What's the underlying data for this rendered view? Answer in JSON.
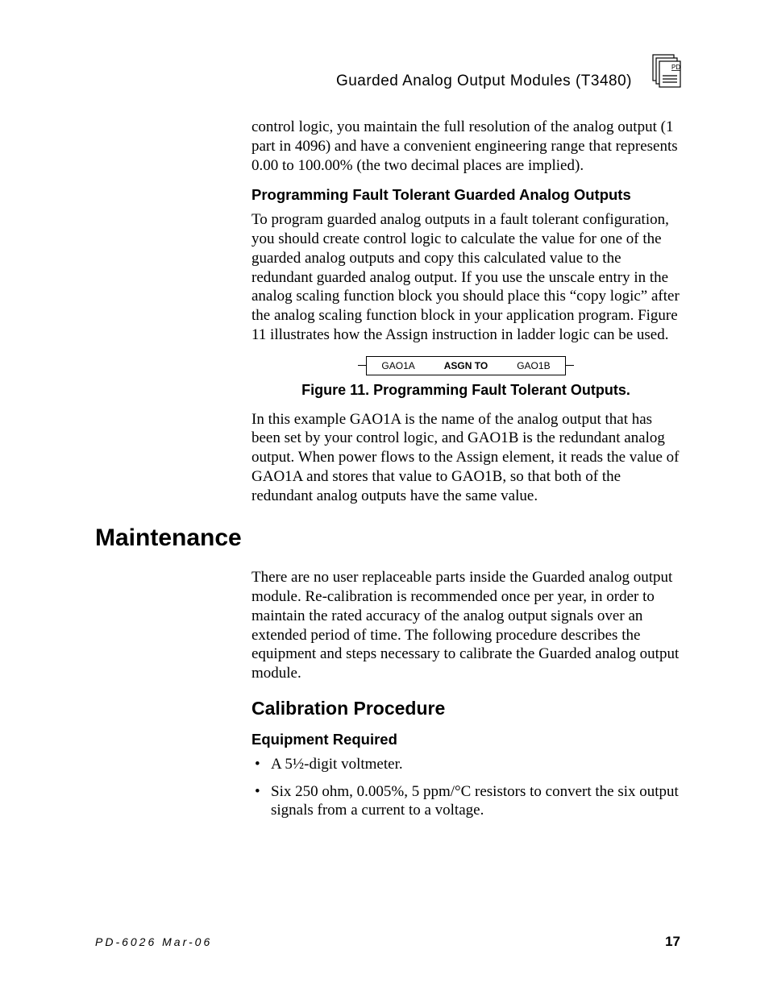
{
  "header": {
    "running_head": "Guarded  Analog  Output  Modules (T3480)"
  },
  "paragraphs": {
    "p1": "control logic, you maintain the full resolution of the analog output (1 part in 4096) and have a convenient engineering range that represents 0.00 to 100.00% (the two decimal places are implied).",
    "h1": "Programming Fault Tolerant Guarded Analog Outputs",
    "p2": "To program guarded analog outputs in a fault tolerant configuration, you should create control logic to calculate the value for one of the guarded analog outputs and copy this calculated value to the redundant guarded analog output.  If you use the unscale entry in the analog scaling function block you should place this “copy logic” after the analog scaling function block in your application program.  Figure 11 illustrates how the Assign instruction in ladder logic can be used.",
    "fig_left": "GAO1A",
    "fig_mid": "ASGN TO",
    "fig_right": "GAO1B",
    "fig_caption": "Figure 11.  Programming Fault Tolerant Outputs.",
    "p3": "In this example GAO1A is the name of the analog output that has been set by your control logic, and GAO1B is the redundant analog output.  When power flows to the Assign element, it reads the value of GAO1A and stores that value to GAO1B, so that both of the redundant analog outputs have the same value.",
    "section": "Maintenance",
    "p4": "There are no user replaceable parts inside the Guarded analog output module.  Re-calibration is recommended once per year, in order to maintain the rated accuracy of the analog output signals over an extended period of time.  The following procedure describes the equipment and steps necessary to calibrate the Guarded analog output module.",
    "subsection": "Calibration Procedure",
    "h2": "Equipment Required",
    "li1": "A 5½-digit voltmeter.",
    "li2": "Six 250 ohm, 0.005%, 5 ppm/°C resistors to convert the six output signals from a current to a voltage."
  },
  "footer": {
    "left": "PD-6026 Mar-06",
    "right": "17"
  }
}
